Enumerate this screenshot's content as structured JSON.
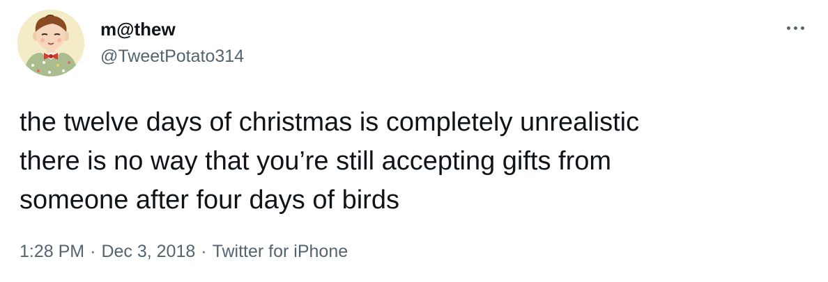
{
  "user": {
    "display_name": "m@thew",
    "handle": "@TweetPotato314",
    "avatar": "cartoon-child-avatar"
  },
  "menu": {
    "icon": "more-horizontal-icon"
  },
  "tweet": {
    "lines": [
      "the twelve days of christmas is completely unrealistic",
      "there is no way that you’re still accepting gifts from",
      "someone after four days of birds"
    ]
  },
  "meta": {
    "time": "1:28 PM",
    "separator": "·",
    "date": "Dec 3, 2018",
    "source": "Twitter for iPhone"
  },
  "colors": {
    "text_primary": "#0f1419",
    "text_secondary": "#536471",
    "background": "#ffffff"
  }
}
